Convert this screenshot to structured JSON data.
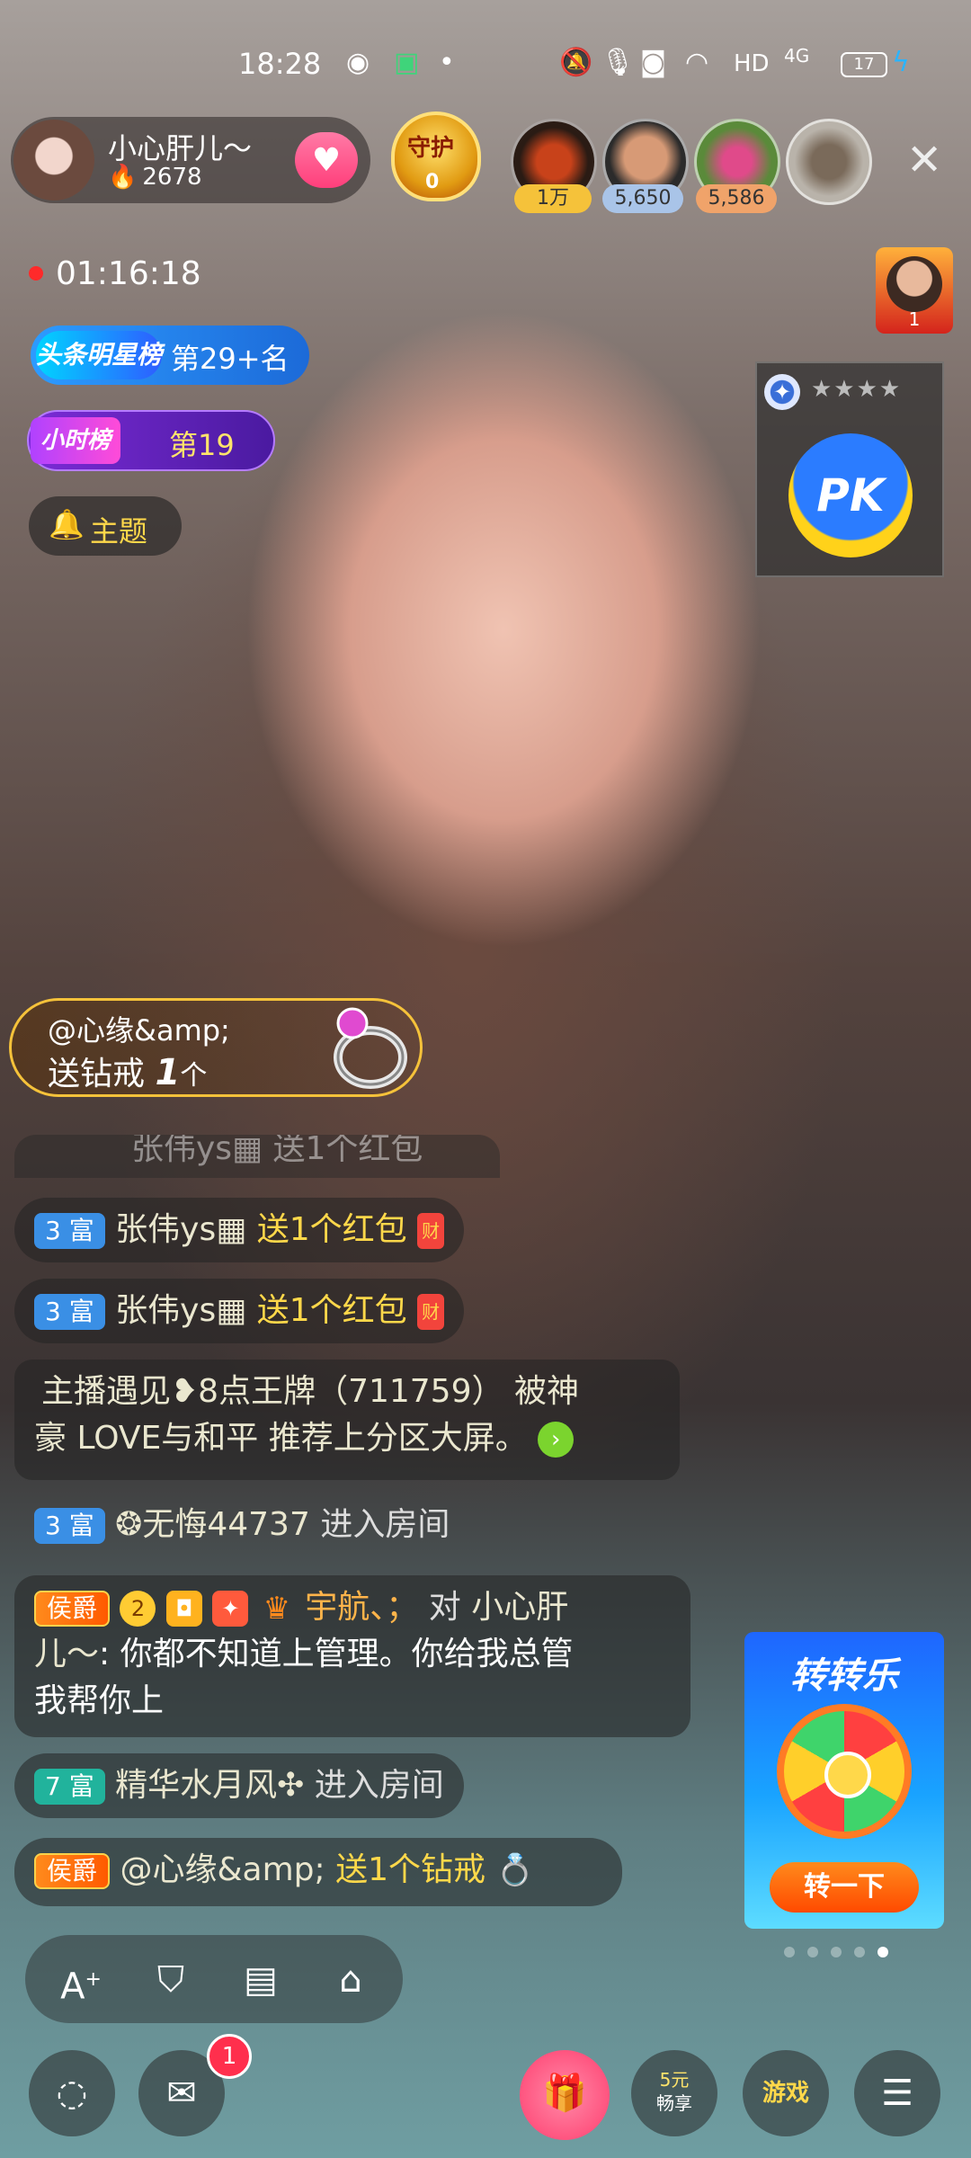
{
  "status_bar": {
    "time": "18:28",
    "network": "HD",
    "signal": "4G",
    "battery": "17"
  },
  "host": {
    "name": "小心肝儿～",
    "heat": "2678"
  },
  "guard": {
    "label": "守护",
    "count": "0"
  },
  "top_fans": [
    {
      "badge": "1万",
      "color": "#f5c23a"
    },
    {
      "badge": "5,650",
      "color": "#a9c4e8"
    },
    {
      "badge": "5,586",
      "color": "#f0a36a"
    }
  ],
  "live_timer": "01:16:18",
  "star_rank": {
    "tag": "头条明星榜",
    "rank": "第29+名"
  },
  "hour_rank": {
    "tag": "小时榜",
    "rank": "第19"
  },
  "theme_label": "主题",
  "right_rank": {
    "number": "1"
  },
  "pk": {
    "label": "PK",
    "stars": "★★★★"
  },
  "gift_banner": {
    "sender": "@心缘&amp;",
    "action": "送钻戒",
    "count": "1",
    "unit": "个"
  },
  "chat": {
    "partial_text": "张伟ys▦ 送1个红包",
    "messages": [
      {
        "level": "3 富",
        "user": "张伟ys▦",
        "text": "送1个红包",
        "icon": "财"
      },
      {
        "level": "3 富",
        "user": "张伟ys▦",
        "text": "送1个红包",
        "icon": "财"
      },
      {
        "line1": "主播遇见❥8点王牌（711759） 被神",
        "line2": "豪 LOVE与和平 推荐上分区大屏。"
      },
      {
        "level": "3 富",
        "user": "❂无悔44737",
        "text": "进入房间"
      },
      {
        "level": "侯爵",
        "user": "宇航、；",
        "to_prefix": "对",
        "to_user": "小心肝",
        "line2_user": "儿～",
        "line2_text": ": 你都不知道上管理。你给我总管",
        "line3": "我帮你上"
      },
      {
        "level": "7 富",
        "user": "精华水月风✣",
        "text": "进入房间"
      },
      {
        "level": "侯爵",
        "user": "@心缘&amp;",
        "text": "送1个钻戒"
      }
    ]
  },
  "wheel_ad": {
    "title": "转转乐",
    "button": "转一下"
  },
  "bottom": {
    "mail_badge": "1",
    "promo_line1": "5元",
    "promo_line2": "畅享",
    "game_label": "游戏"
  }
}
